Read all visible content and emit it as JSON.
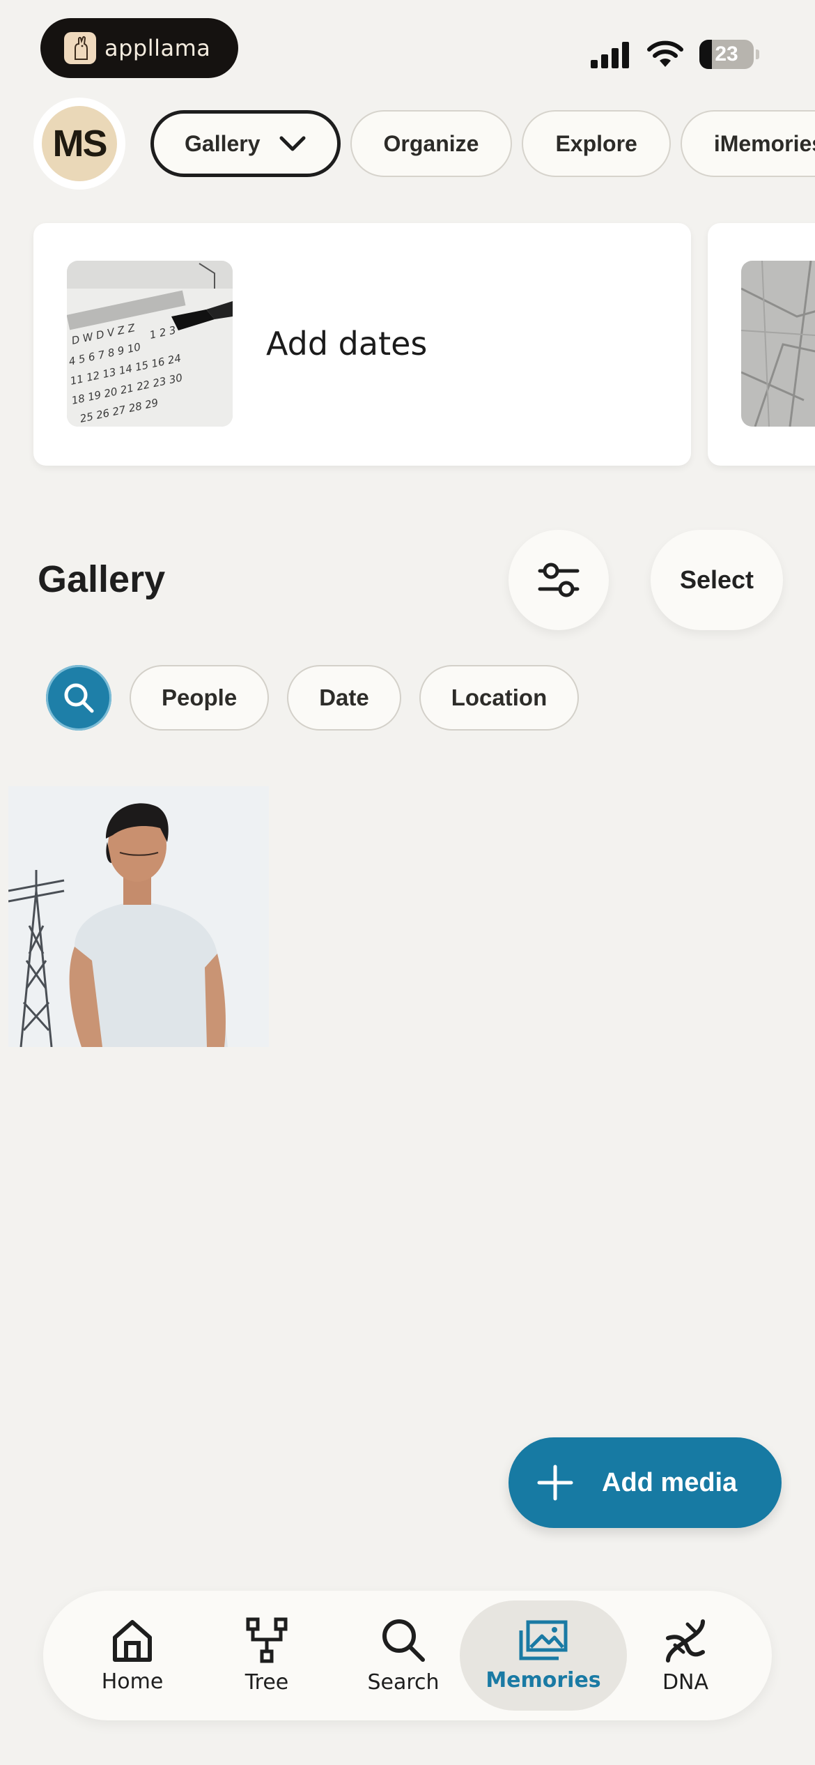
{
  "status_bar": {
    "app_name": "appllama",
    "battery_level": "23"
  },
  "profile": {
    "initials": "MS"
  },
  "top_tabs": [
    {
      "label": "Gallery",
      "active": true
    },
    {
      "label": "Organize",
      "active": false
    },
    {
      "label": "Explore",
      "active": false
    },
    {
      "label": "iMemories",
      "active": false
    }
  ],
  "cards": [
    {
      "title": "Add dates",
      "icon": "calendar-photo"
    },
    {
      "icon": "map-photo"
    }
  ],
  "gallery": {
    "title": "Gallery",
    "select_label": "Select",
    "filter_chips": [
      "People",
      "Date",
      "Location"
    ]
  },
  "fab": {
    "label": "Add media"
  },
  "bottom_nav": [
    {
      "label": "Home",
      "icon": "home-icon",
      "active": false
    },
    {
      "label": "Tree",
      "icon": "tree-icon",
      "active": false
    },
    {
      "label": "Search",
      "icon": "search-icon",
      "active": false
    },
    {
      "label": "Memories",
      "icon": "memories-icon",
      "active": true
    },
    {
      "label": "DNA",
      "icon": "dna-icon",
      "active": false
    }
  ],
  "colors": {
    "background": "#f3f2ef",
    "accent": "#177aa3",
    "accent_text": "#1a7aa4"
  }
}
